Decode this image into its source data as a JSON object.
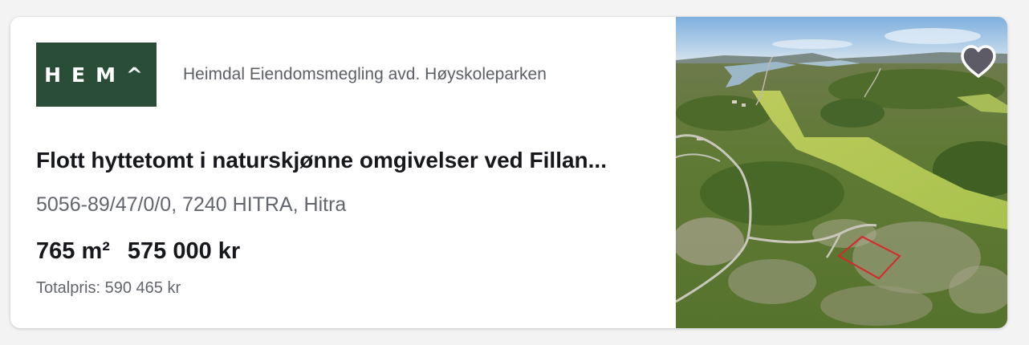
{
  "broker": {
    "logo_text": "HEM^",
    "name": "Heimdal Eiendomsmegling avd. Høyskoleparken"
  },
  "listing": {
    "title": "Flott hyttetomt i naturskjønne omgivelser ved Fillan...",
    "address": "5056-89/47/0/0, 7240 HITRA, Hitra",
    "area": "765 m²",
    "price": "575 000 kr",
    "total_price": "Totalpris: 590 465 kr"
  },
  "icons": {
    "favorite": "heart-icon"
  },
  "colors": {
    "logo_background": "#2a4d38",
    "plot_outline": "#d8262c"
  }
}
